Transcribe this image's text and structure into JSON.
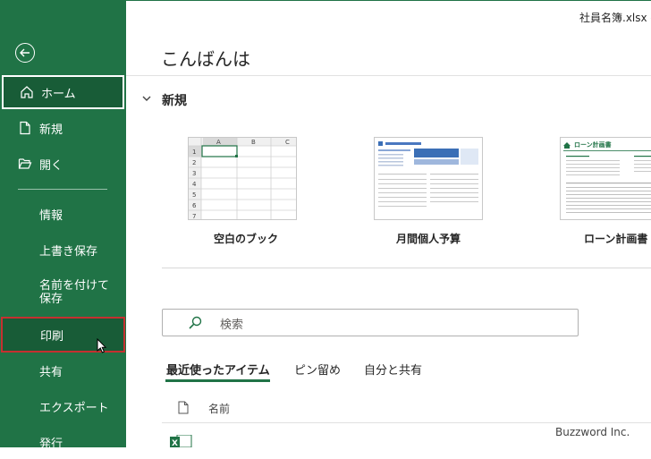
{
  "window": {
    "doc_title": "社員名簿.xlsx -"
  },
  "sidebar": {
    "items": [
      {
        "label": "ホーム",
        "icon": "home-icon"
      },
      {
        "label": "新規",
        "icon": "new-file-icon"
      },
      {
        "label": "開く",
        "icon": "folder-open-icon"
      },
      {
        "label": "情報"
      },
      {
        "label": "上書き保存"
      },
      {
        "label": "名前を付けて保存"
      },
      {
        "label": "印刷"
      },
      {
        "label": "共有"
      },
      {
        "label": "エクスポート"
      },
      {
        "label": "発行"
      }
    ],
    "back_icon": "back-arrow-icon",
    "selected": "ホーム",
    "highlighted": "印刷"
  },
  "main": {
    "greeting": "こんばんは",
    "new_section": {
      "title": "新規",
      "templates": [
        {
          "label": "空白のブック",
          "columns": [
            "A",
            "B",
            "C"
          ],
          "rows": [
            "1",
            "2",
            "3",
            "4",
            "5",
            "6",
            "7"
          ]
        },
        {
          "label": "月間個人予算"
        },
        {
          "label": "ローン計画書",
          "thumb_title": "ローン計画書"
        }
      ]
    },
    "search": {
      "placeholder": "検索"
    },
    "tabs": [
      {
        "label": "最近使ったアイテム",
        "active": true
      },
      {
        "label": "ピン留め"
      },
      {
        "label": "自分と共有"
      }
    ],
    "list_header": {
      "name": "名前"
    }
  },
  "watermark": "Buzzword Inc.",
  "colors": {
    "accent": "#207346",
    "sidebar_selected": "#185c37",
    "highlight_border": "#c53030"
  }
}
